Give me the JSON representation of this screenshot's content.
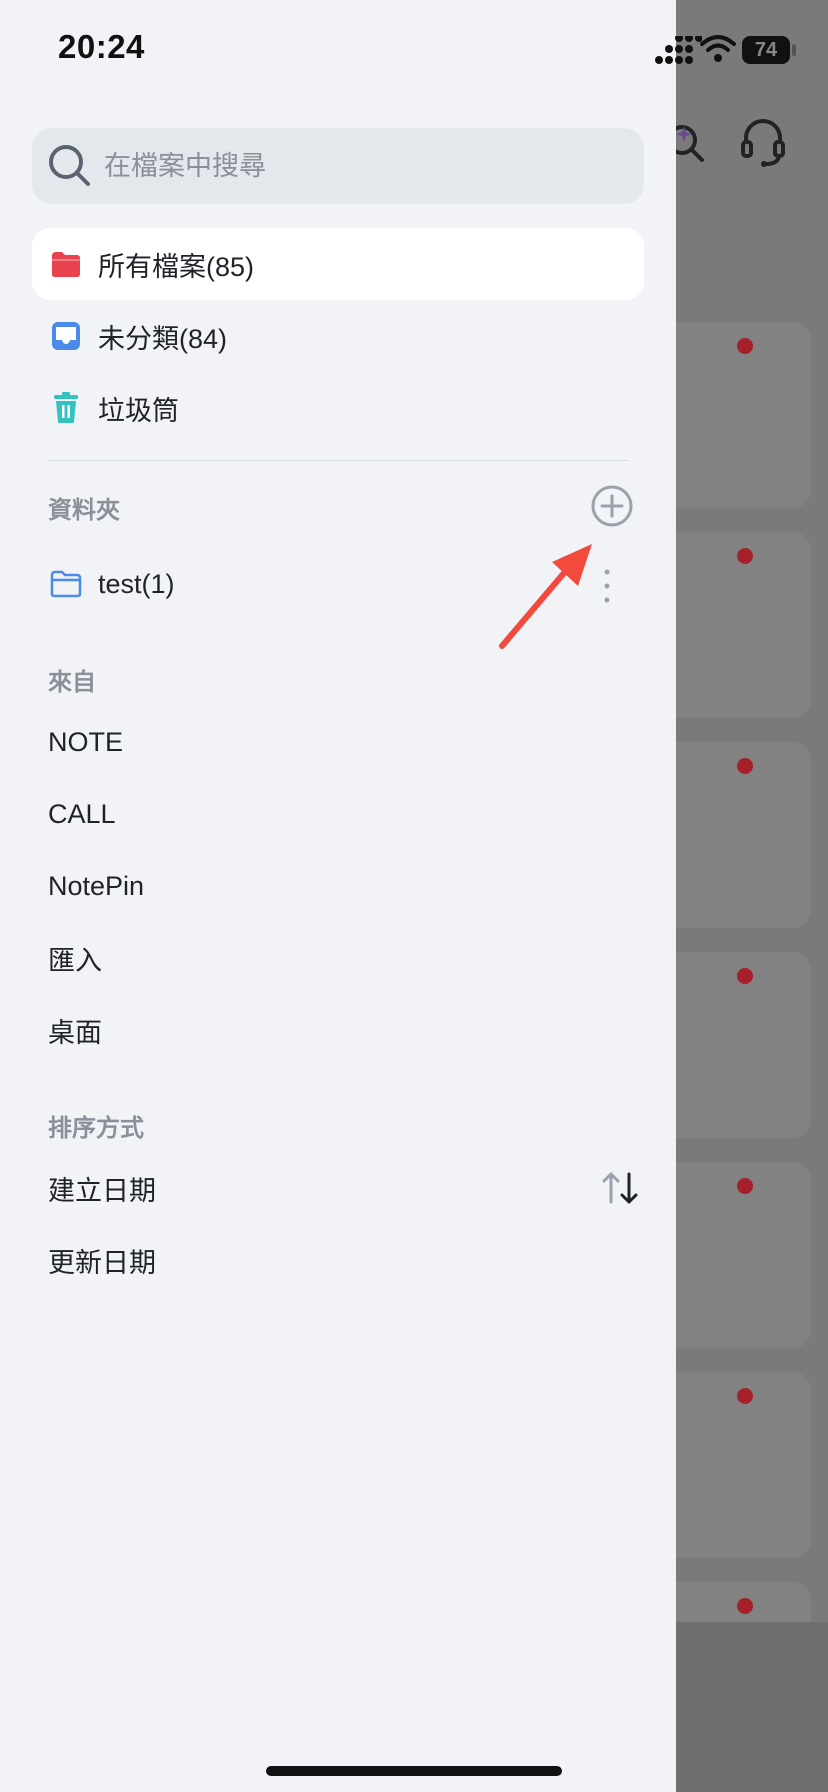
{
  "status": {
    "time": "20:24",
    "battery": "74"
  },
  "search": {
    "placeholder": "在檔案中搜尋"
  },
  "nav": [
    {
      "label": "所有檔案(85)",
      "icon": "red-folder-icon",
      "active": true
    },
    {
      "label": "未分類(84)",
      "icon": "inbox-icon",
      "active": false
    },
    {
      "label": "垃圾筒",
      "icon": "trash-icon",
      "active": false
    }
  ],
  "folders": {
    "title": "資料夾",
    "items": [
      {
        "label": "test(1)",
        "icon": "folder-outline-icon"
      }
    ]
  },
  "sources": {
    "title": "來自",
    "items": [
      "NOTE",
      "CALL",
      "NotePin",
      "匯入",
      "桌面"
    ]
  },
  "sort": {
    "title": "排序方式",
    "items": [
      "建立日期",
      "更新日期"
    ]
  },
  "colors": {
    "accent_red": "#e8424f",
    "accent_blue": "#4a8ae8",
    "accent_teal": "#34c2c0",
    "label_gray": "#8a9099",
    "annotation_arrow": "#f24a3d"
  }
}
